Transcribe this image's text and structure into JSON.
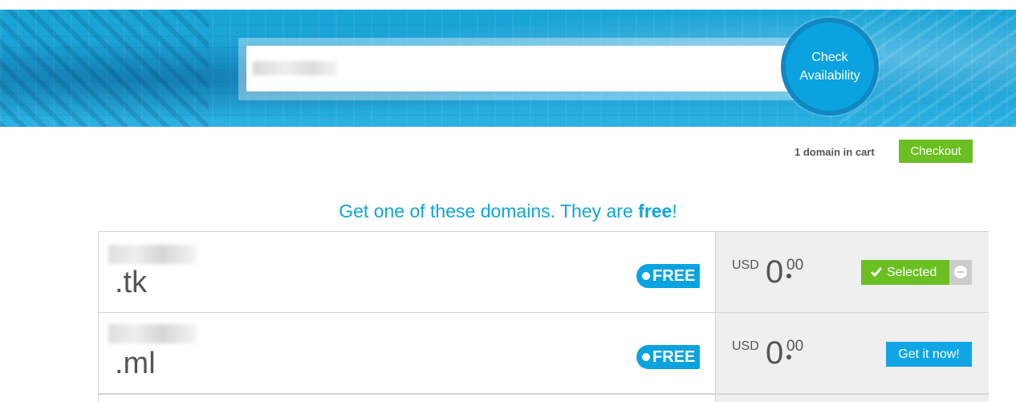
{
  "search": {
    "value": "",
    "check_button_line1": "Check",
    "check_button_line2": "Availability"
  },
  "cart": {
    "count_text": "1 domain in cart",
    "checkout_label": "Checkout"
  },
  "headline": {
    "prefix": "Get one of these domains. They are ",
    "emphasis": "free",
    "suffix": "!"
  },
  "domains": [
    {
      "tld": ".tk",
      "badge": "FREE",
      "currency": "USD",
      "price_int": "0",
      "price_dec": "00",
      "action_label": "Selected",
      "selected": true
    },
    {
      "tld": ".ml",
      "badge": "FREE",
      "currency": "USD",
      "price_int": "0",
      "price_dec": "00",
      "action_label": "Get it now!",
      "selected": false
    }
  ],
  "colors": {
    "accent_blue": "#0aa3e0",
    "green": "#6bbf22",
    "text_gray": "#555555"
  }
}
